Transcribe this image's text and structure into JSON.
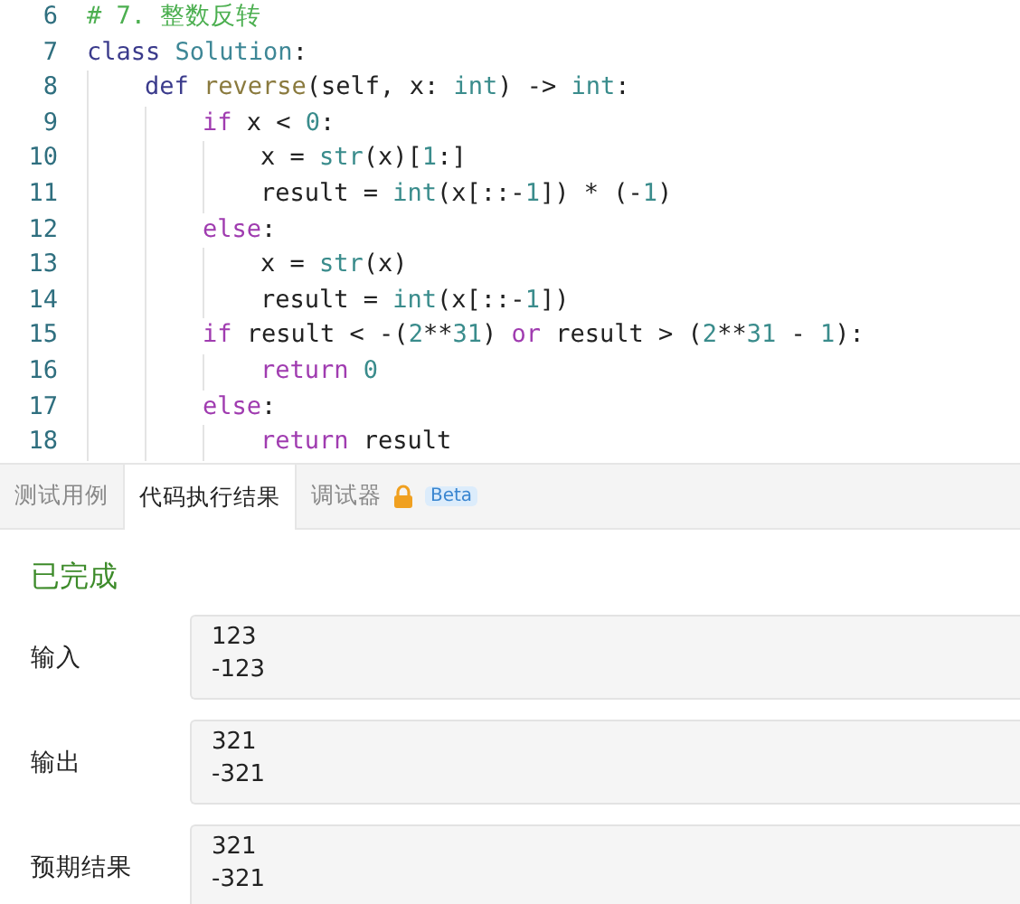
{
  "editor": {
    "lines": [
      {
        "number": "6",
        "tokens": [
          {
            "kind": "comment",
            "text": "# 7. 整数反转"
          }
        ]
      },
      {
        "number": "7",
        "tokens": [
          {
            "kind": "keyword2",
            "text": "class "
          },
          {
            "kind": "classname",
            "text": "Solution"
          },
          {
            "kind": "plain",
            "text": ":"
          }
        ],
        "children": [
          {
            "number": "8",
            "tokens": [
              {
                "kind": "keyword2",
                "text": "def "
              },
              {
                "kind": "function",
                "text": "reverse"
              },
              {
                "kind": "plain",
                "text": "(self, x: "
              },
              {
                "kind": "builtin",
                "text": "int"
              },
              {
                "kind": "plain",
                "text": ") -> "
              },
              {
                "kind": "builtin",
                "text": "int"
              },
              {
                "kind": "plain",
                "text": ":"
              }
            ],
            "children": [
              {
                "number": "9",
                "tokens": [
                  {
                    "kind": "keyword",
                    "text": "if"
                  },
                  {
                    "kind": "plain",
                    "text": " x < "
                  },
                  {
                    "kind": "number",
                    "text": "0"
                  },
                  {
                    "kind": "plain",
                    "text": ":"
                  }
                ],
                "children": [
                  {
                    "number": "10",
                    "tokens": [
                      {
                        "kind": "plain",
                        "text": "x = "
                      },
                      {
                        "kind": "builtin",
                        "text": "str"
                      },
                      {
                        "kind": "plain",
                        "text": "(x)["
                      },
                      {
                        "kind": "number",
                        "text": "1"
                      },
                      {
                        "kind": "plain",
                        "text": ":]"
                      }
                    ]
                  },
                  {
                    "number": "11",
                    "tokens": [
                      {
                        "kind": "plain",
                        "text": "result = "
                      },
                      {
                        "kind": "builtin",
                        "text": "int"
                      },
                      {
                        "kind": "plain",
                        "text": "(x[::-"
                      },
                      {
                        "kind": "number",
                        "text": "1"
                      },
                      {
                        "kind": "plain",
                        "text": "]) * (-"
                      },
                      {
                        "kind": "number",
                        "text": "1"
                      },
                      {
                        "kind": "plain",
                        "text": ")"
                      }
                    ]
                  }
                ]
              },
              {
                "number": "12",
                "tokens": [
                  {
                    "kind": "keyword",
                    "text": "else"
                  },
                  {
                    "kind": "plain",
                    "text": ":"
                  }
                ],
                "children": [
                  {
                    "number": "13",
                    "tokens": [
                      {
                        "kind": "plain",
                        "text": "x = "
                      },
                      {
                        "kind": "builtin",
                        "text": "str"
                      },
                      {
                        "kind": "plain",
                        "text": "(x)"
                      }
                    ]
                  },
                  {
                    "number": "14",
                    "tokens": [
                      {
                        "kind": "plain",
                        "text": "result = "
                      },
                      {
                        "kind": "builtin",
                        "text": "int"
                      },
                      {
                        "kind": "plain",
                        "text": "(x[::-"
                      },
                      {
                        "kind": "number",
                        "text": "1"
                      },
                      {
                        "kind": "plain",
                        "text": "])"
                      }
                    ]
                  }
                ]
              },
              {
                "number": "15",
                "tokens": [
                  {
                    "kind": "keyword",
                    "text": "if"
                  },
                  {
                    "kind": "plain",
                    "text": " result < -("
                  },
                  {
                    "kind": "number",
                    "text": "2"
                  },
                  {
                    "kind": "plain",
                    "text": "**"
                  },
                  {
                    "kind": "number",
                    "text": "31"
                  },
                  {
                    "kind": "plain",
                    "text": ") "
                  },
                  {
                    "kind": "keyword",
                    "text": "or"
                  },
                  {
                    "kind": "plain",
                    "text": " result > ("
                  },
                  {
                    "kind": "number",
                    "text": "2"
                  },
                  {
                    "kind": "plain",
                    "text": "**"
                  },
                  {
                    "kind": "number",
                    "text": "31"
                  },
                  {
                    "kind": "plain",
                    "text": " - "
                  },
                  {
                    "kind": "number",
                    "text": "1"
                  },
                  {
                    "kind": "plain",
                    "text": "):"
                  }
                ],
                "children": [
                  {
                    "number": "16",
                    "tokens": [
                      {
                        "kind": "keyword",
                        "text": "return"
                      },
                      {
                        "kind": "number",
                        "text": " 0"
                      }
                    ]
                  }
                ]
              },
              {
                "number": "17",
                "tokens": [
                  {
                    "kind": "keyword",
                    "text": "else"
                  },
                  {
                    "kind": "plain",
                    "text": ":"
                  }
                ],
                "children": [
                  {
                    "number": "18",
                    "tokens": [
                      {
                        "kind": "keyword",
                        "text": "return"
                      },
                      {
                        "kind": "plain",
                        "text": " result"
                      }
                    ]
                  }
                ]
              }
            ]
          }
        ]
      }
    ]
  },
  "tabs": [
    {
      "label": "测试用例",
      "selected": false
    },
    {
      "label": "代码执行结果",
      "selected": true
    },
    {
      "label": "调试器",
      "selected": false,
      "locked": true,
      "badge": "Beta"
    }
  ],
  "status": "已完成",
  "results": [
    {
      "label": "输入",
      "lines": [
        "123",
        "-123"
      ]
    },
    {
      "label": "输出",
      "lines": [
        "321",
        "-321"
      ]
    },
    {
      "label": "预期结果",
      "lines": [
        "321",
        "-321"
      ]
    }
  ]
}
